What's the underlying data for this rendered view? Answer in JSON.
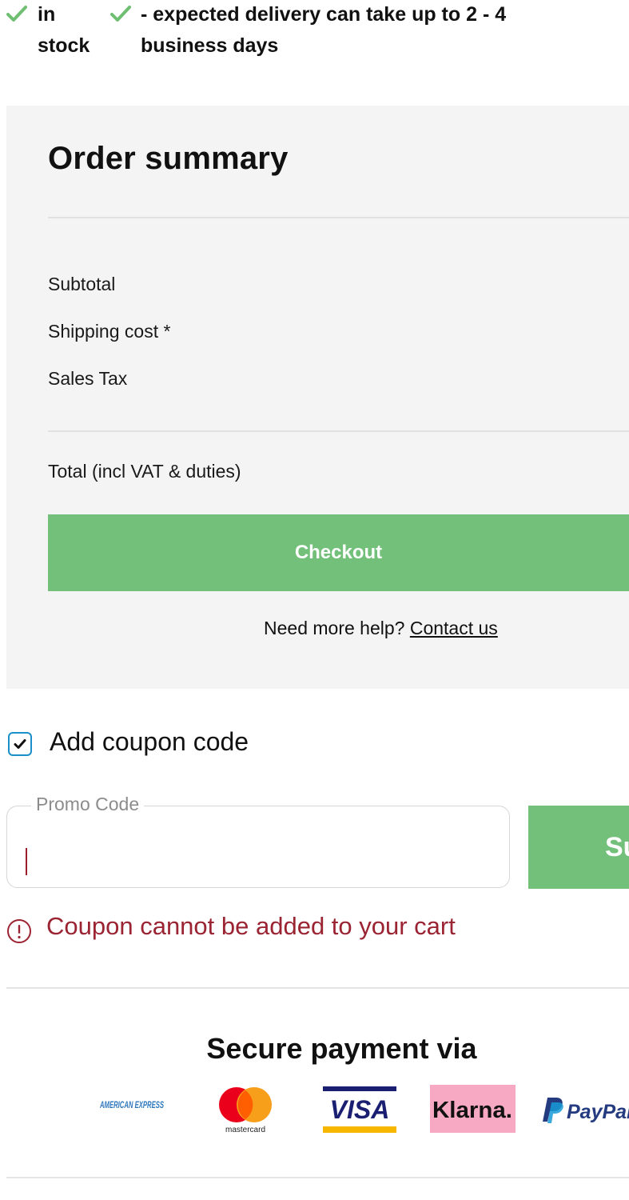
{
  "availability": {
    "stock_label": "in stock",
    "delivery_label": "- expected delivery can take up to 2 - 4 business days"
  },
  "summary": {
    "title": "Order summary",
    "subtotal_label": "Subtotal",
    "shipping_label": "Shipping cost *",
    "tax_label": "Sales Tax",
    "total_label": "Total (incl VAT & duties)",
    "checkout_label": "Checkout",
    "help_text": "Need more help?",
    "contact_link": "Contact us"
  },
  "coupon": {
    "checkbox_label": "Add coupon code",
    "checked": true,
    "promo_legend": "Promo Code",
    "promo_value": "",
    "submit_label": "Submit",
    "error_message": "Coupon cannot be added to your cart"
  },
  "payment": {
    "title": "Secure payment via",
    "methods": [
      {
        "name": "American Express",
        "logo_text": "AMERICAN EXPRESS",
        "icon": "amex-logo"
      },
      {
        "name": "Mastercard",
        "logo_text": "mastercard",
        "icon": "mastercard-logo"
      },
      {
        "name": "Visa",
        "logo_text": "VISA",
        "icon": "visa-logo"
      },
      {
        "name": "Klarna",
        "logo_text": "Klarna.",
        "icon": "klarna-logo"
      },
      {
        "name": "PayPal",
        "logo_text": "PayPal",
        "icon": "paypal-logo"
      }
    ]
  },
  "colors": {
    "check_green": "#6fbf73",
    "button_green": "#72c07a",
    "panel_bg": "#f4f4f4",
    "error_red": "#9b2433",
    "checkbox_blue": "#1a8fc9",
    "klarna_pink": "#f7a9c3",
    "visa_blue": "#1a1f71",
    "visa_gold": "#f7b600",
    "amex_blue": "#2e77bc",
    "paypal_navy": "#253b80",
    "paypal_blue": "#179bd7"
  }
}
